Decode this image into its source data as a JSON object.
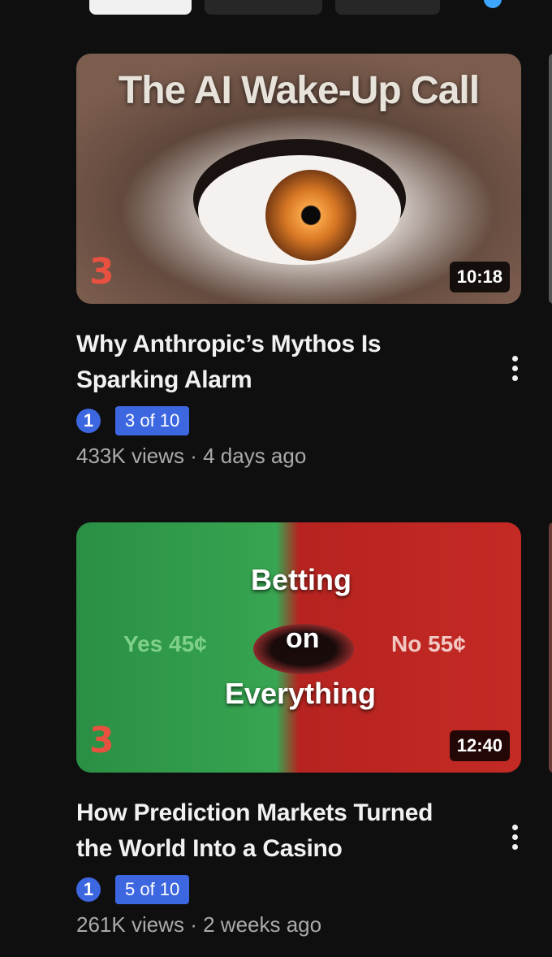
{
  "videos": [
    {
      "thumbnail_text": "The AI Wake-Up Call",
      "logo": "3",
      "duration": "10:18",
      "title": "Why Anthropic’s Mythos Is Sparking Alarm",
      "badge_number": "1",
      "position": "3 of 10",
      "views": "433K views",
      "age": "4 days ago"
    },
    {
      "thumbnail_text": {
        "line1": "Betting",
        "line2": "on",
        "line3": "Everything",
        "yes": "Yes 45¢",
        "no": "No 55¢"
      },
      "logo": "3",
      "duration": "12:40",
      "title": "How Prediction Markets Turned the World Into a Casino",
      "badge_number": "1",
      "position": "5 of 10",
      "views": "261K views",
      "age": "2 weeks ago"
    }
  ],
  "separator": "·",
  "colors": {
    "background": "#0f0f0f",
    "badge": "#3d67e0",
    "meta": "#aaaaaa"
  }
}
